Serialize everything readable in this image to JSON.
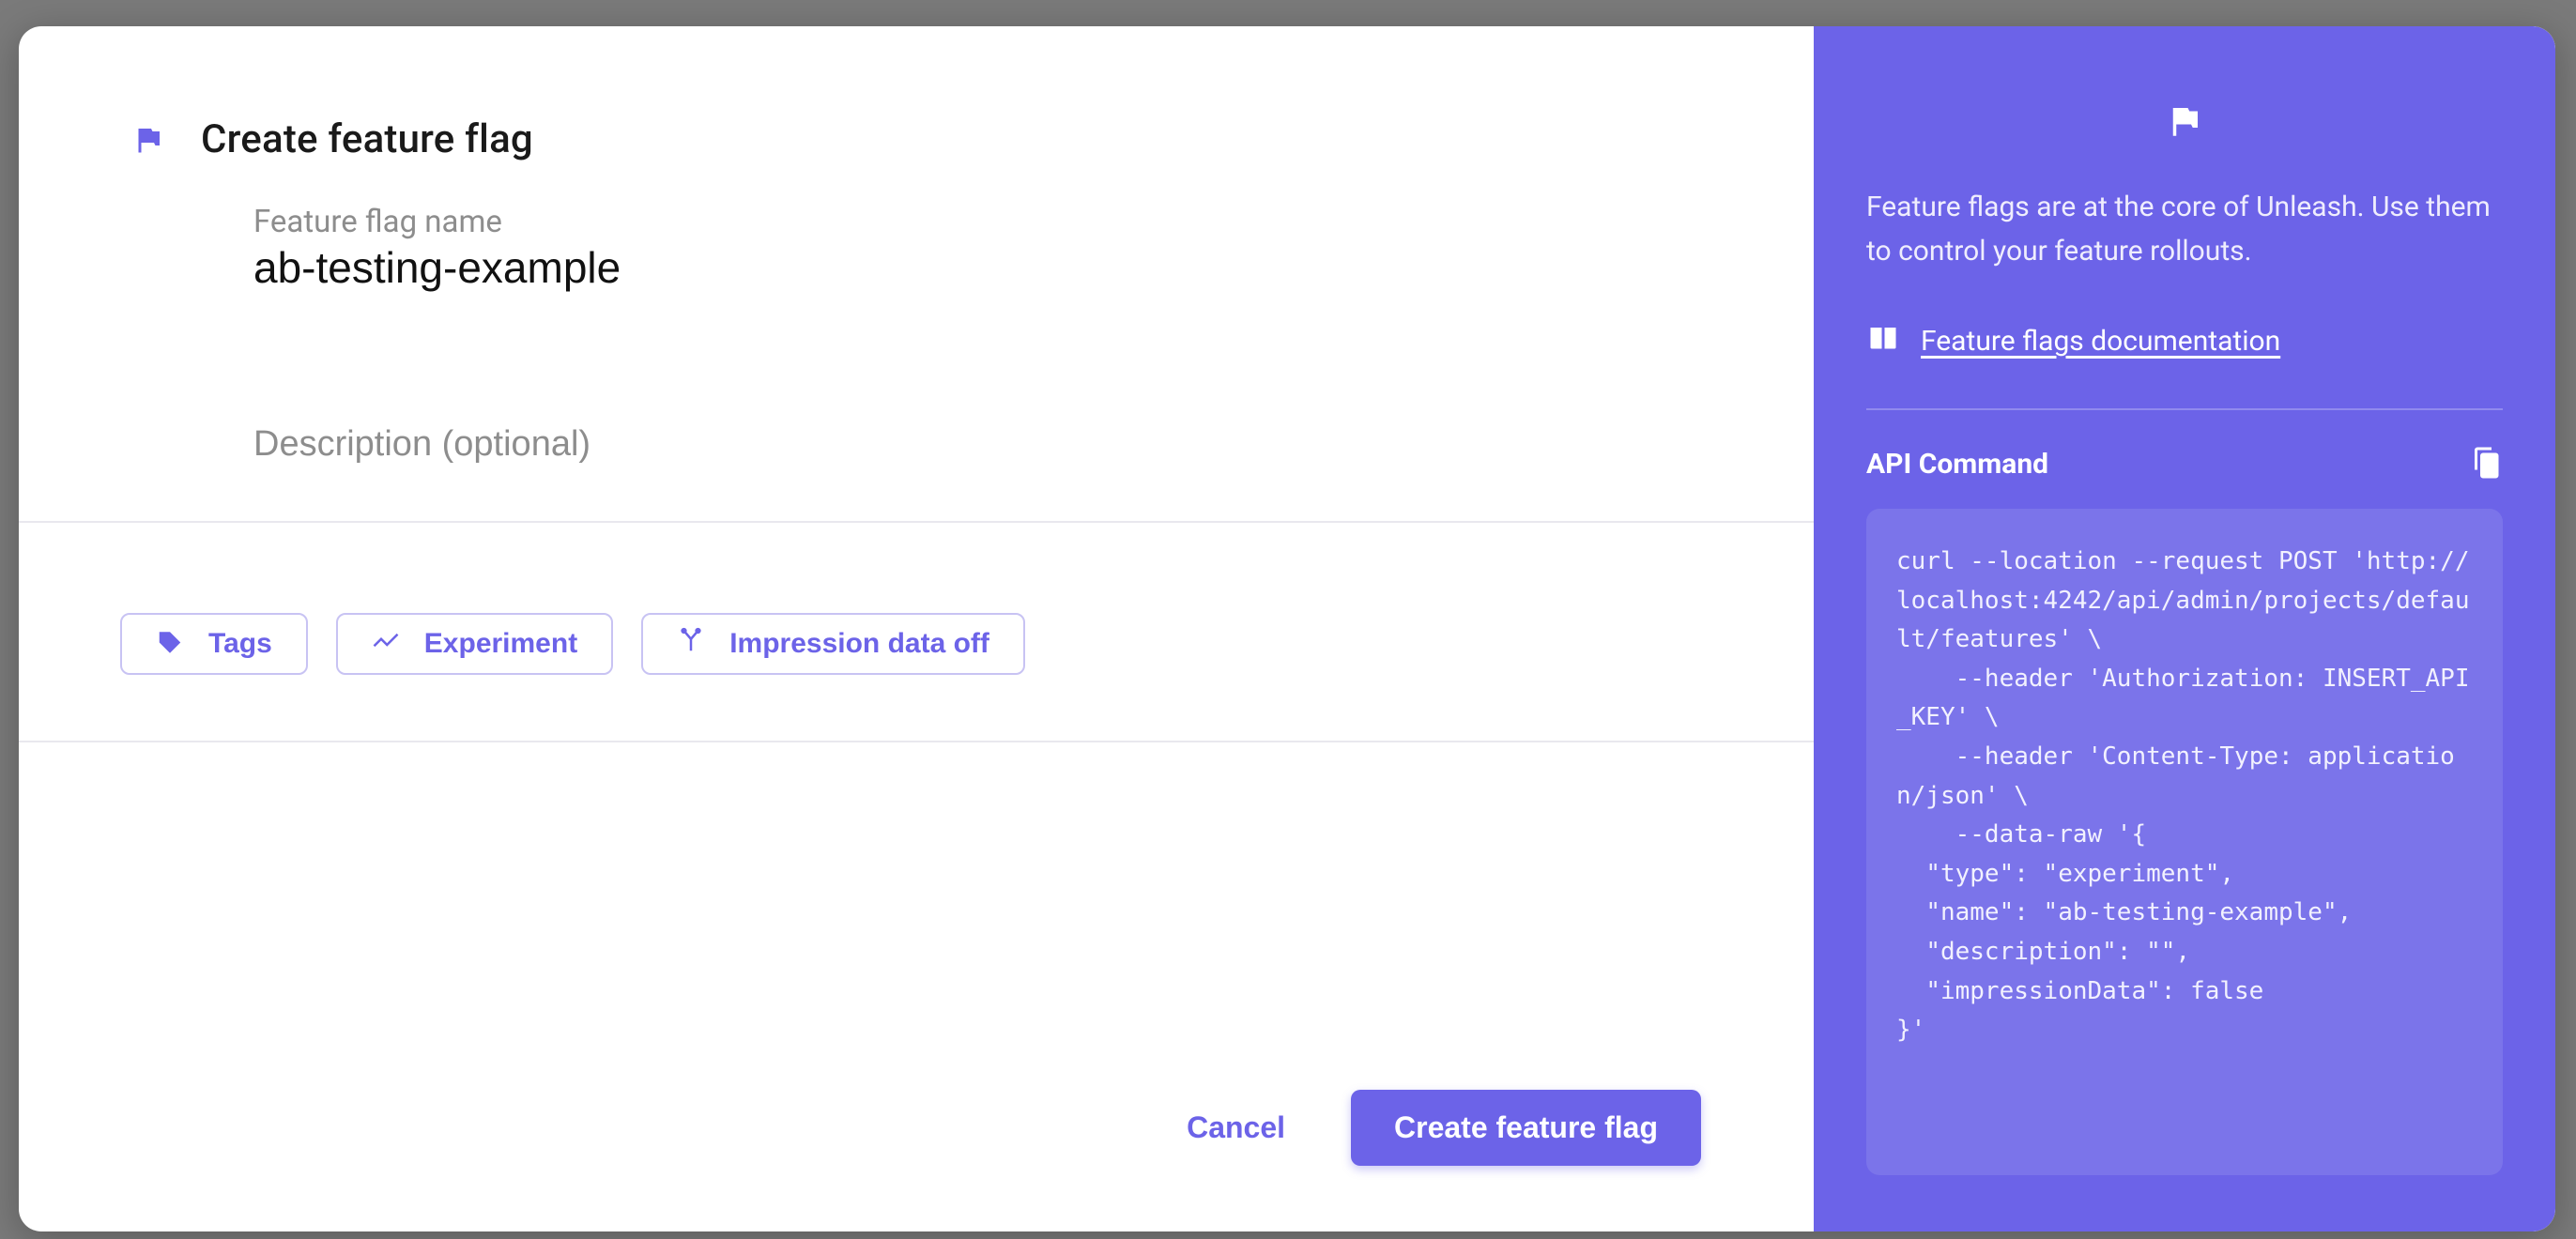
{
  "header": {
    "title": "Create feature flag"
  },
  "form": {
    "name_label": "Feature flag name",
    "name_value": "ab-testing-example",
    "description_placeholder": "Description (optional)",
    "description_value": ""
  },
  "chips": {
    "tags": "Tags",
    "experiment": "Experiment",
    "impression": "Impression data off"
  },
  "footer": {
    "cancel": "Cancel",
    "submit": "Create feature flag"
  },
  "sidebar": {
    "intro": "Feature flags are at the core of Unleash. Use them to control your feature rollouts.",
    "doc_link": "Feature flags documentation",
    "api_title": "API Command",
    "api_code": "curl --location --request POST 'http://localhost:4242/api/admin/projects/default/features' \\\n    --header 'Authorization: INSERT_API_KEY' \\\n    --header 'Content-Type: application/json' \\\n    --data-raw '{\n  \"type\": \"experiment\",\n  \"name\": \"ab-testing-example\",\n  \"description\": \"\",\n  \"impressionData\": false\n}'"
  }
}
